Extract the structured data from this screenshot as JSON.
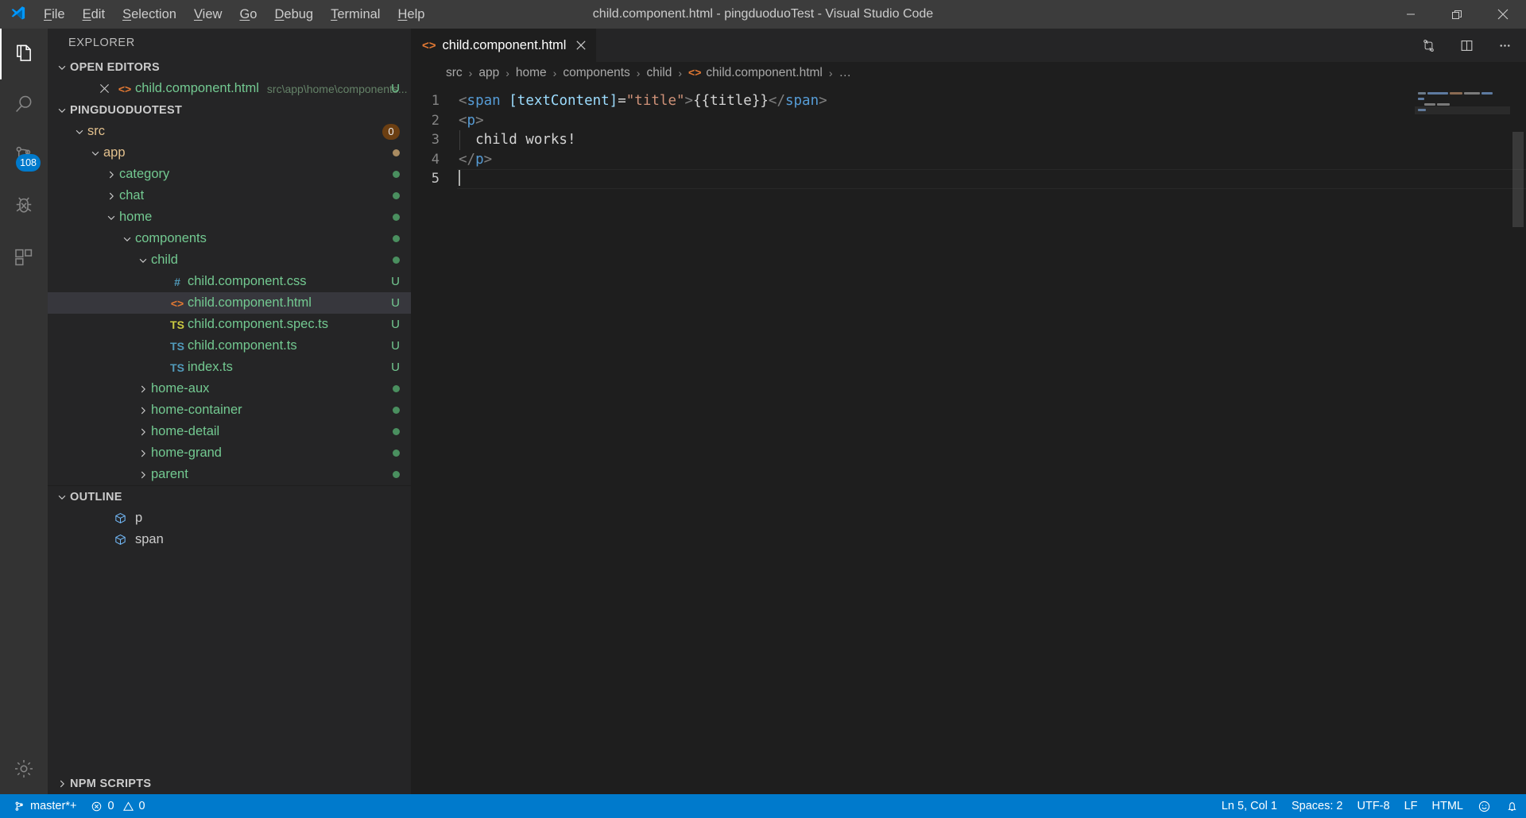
{
  "window": {
    "title": "child.component.html - pingduoduoTest - Visual Studio Code",
    "minimize_label": "Minimize",
    "maximize_label": "Restore",
    "close_label": "Close"
  },
  "menu": {
    "items": [
      {
        "label": "File",
        "mnemonic": "F"
      },
      {
        "label": "Edit",
        "mnemonic": "E"
      },
      {
        "label": "Selection",
        "mnemonic": "S"
      },
      {
        "label": "View",
        "mnemonic": "V"
      },
      {
        "label": "Go",
        "mnemonic": "G"
      },
      {
        "label": "Debug",
        "mnemonic": "D"
      },
      {
        "label": "Terminal",
        "mnemonic": "T"
      },
      {
        "label": "Help",
        "mnemonic": "H"
      }
    ]
  },
  "activitybar": {
    "items": [
      {
        "name": "explorer",
        "icon": "files-icon",
        "badge": null,
        "active": true
      },
      {
        "name": "search",
        "icon": "search-icon",
        "badge": null,
        "active": false
      },
      {
        "name": "source-control",
        "icon": "git-branch-icon",
        "badge": "108",
        "active": false
      },
      {
        "name": "debug",
        "icon": "bug-icon",
        "badge": null,
        "active": false
      },
      {
        "name": "extensions",
        "icon": "extensions-icon",
        "badge": null,
        "active": false
      },
      {
        "name": "manage",
        "icon": "gear-icon",
        "badge": null,
        "active": false
      }
    ]
  },
  "sidebar": {
    "title": "EXPLORER",
    "open_editors": {
      "header": "OPEN EDITORS",
      "expanded": true,
      "items": [
        {
          "label": "child.component.html",
          "description": "src\\app\\home\\components...",
          "icon": "html-file-icon",
          "badge": "U",
          "badge_color": "#73c991"
        }
      ]
    },
    "project": {
      "header": "PINGDUODUOTEST",
      "expanded": true,
      "items": [
        {
          "label": "src",
          "depth": 0,
          "type": "folder",
          "expanded": true,
          "color": "#e2c08d",
          "badge": "0",
          "badge_type": "count"
        },
        {
          "label": "app",
          "depth": 1,
          "type": "folder",
          "expanded": true,
          "color": "#e2c08d",
          "badge": "",
          "badge_type": "dot",
          "badge_color": "#a98b61"
        },
        {
          "label": "category",
          "depth": 2,
          "type": "folder",
          "expanded": false,
          "color": "#73c991",
          "badge": "",
          "badge_type": "dot",
          "badge_color": "#4a8f5f"
        },
        {
          "label": "chat",
          "depth": 2,
          "type": "folder",
          "expanded": false,
          "color": "#73c991",
          "badge": "",
          "badge_type": "dot",
          "badge_color": "#4a8f5f"
        },
        {
          "label": "home",
          "depth": 2,
          "type": "folder",
          "expanded": true,
          "color": "#73c991",
          "badge": "",
          "badge_type": "dot",
          "badge_color": "#4a8f5f"
        },
        {
          "label": "components",
          "depth": 3,
          "type": "folder",
          "expanded": true,
          "color": "#73c991",
          "badge": "",
          "badge_type": "dot",
          "badge_color": "#4a8f5f"
        },
        {
          "label": "child",
          "depth": 4,
          "type": "folder",
          "expanded": true,
          "color": "#73c991",
          "badge": "",
          "badge_type": "dot",
          "badge_color": "#4a8f5f"
        },
        {
          "label": "child.component.css",
          "depth": 5,
          "type": "file",
          "icon": "css-file-icon",
          "color": "#73c991",
          "badge": "U",
          "badge_type": "letter",
          "badge_color": "#73c991"
        },
        {
          "label": "child.component.html",
          "depth": 5,
          "type": "file",
          "icon": "html-file-icon",
          "color": "#73c991",
          "badge": "U",
          "badge_type": "letter",
          "badge_color": "#73c991",
          "selected": true
        },
        {
          "label": "child.component.spec.ts",
          "depth": 5,
          "type": "file",
          "icon": "ts-test-file-icon",
          "color": "#73c991",
          "badge": "U",
          "badge_type": "letter",
          "badge_color": "#73c991"
        },
        {
          "label": "child.component.ts",
          "depth": 5,
          "type": "file",
          "icon": "ts-file-icon",
          "color": "#73c991",
          "badge": "U",
          "badge_type": "letter",
          "badge_color": "#73c991"
        },
        {
          "label": "index.ts",
          "depth": 5,
          "type": "file",
          "icon": "ts-file-icon",
          "color": "#73c991",
          "badge": "U",
          "badge_type": "letter",
          "badge_color": "#73c991"
        },
        {
          "label": "home-aux",
          "depth": 4,
          "type": "folder",
          "expanded": false,
          "color": "#73c991",
          "badge": "",
          "badge_type": "dot",
          "badge_color": "#4a8f5f"
        },
        {
          "label": "home-container",
          "depth": 4,
          "type": "folder",
          "expanded": false,
          "color": "#73c991",
          "badge": "",
          "badge_type": "dot",
          "badge_color": "#4a8f5f"
        },
        {
          "label": "home-detail",
          "depth": 4,
          "type": "folder",
          "expanded": false,
          "color": "#73c991",
          "badge": "",
          "badge_type": "dot",
          "badge_color": "#4a8f5f"
        },
        {
          "label": "home-grand",
          "depth": 4,
          "type": "folder",
          "expanded": false,
          "color": "#73c991",
          "badge": "",
          "badge_type": "dot",
          "badge_color": "#4a8f5f"
        },
        {
          "label": "parent",
          "depth": 4,
          "type": "folder",
          "expanded": false,
          "color": "#73c991",
          "badge": "",
          "badge_type": "dot",
          "badge_color": "#4a8f5f"
        }
      ]
    },
    "outline": {
      "header": "OUTLINE",
      "expanded": true,
      "items": [
        {
          "label": "p",
          "icon": "symbol-module-icon"
        },
        {
          "label": "span",
          "icon": "symbol-module-icon"
        }
      ]
    },
    "npm_scripts": {
      "header": "NPM SCRIPTS",
      "expanded": false
    }
  },
  "editor": {
    "tab": {
      "label": "child.component.html",
      "icon": "html-file-icon",
      "close_label": "×",
      "dirty": false
    },
    "actions": [
      {
        "name": "open-changes-icon"
      },
      {
        "name": "split-editor-icon"
      },
      {
        "name": "more-actions-icon"
      }
    ],
    "breadcrumbs": [
      {
        "label": "src"
      },
      {
        "label": "app"
      },
      {
        "label": "home"
      },
      {
        "label": "components"
      },
      {
        "label": "child"
      },
      {
        "label": "child.component.html",
        "icon": "html-file-icon"
      },
      {
        "label": "…"
      }
    ],
    "line_numbers": [
      "1",
      "2",
      "3",
      "4",
      "5"
    ],
    "active_line": 5,
    "lines": [
      {
        "n": 1,
        "tokens": [
          {
            "t": "<",
            "c": "tok-brk"
          },
          {
            "t": "span",
            "c": "tok-tag"
          },
          {
            "t": " ",
            "c": "tok-txt"
          },
          {
            "t": "[textContent]",
            "c": "tok-attr"
          },
          {
            "t": "=",
            "c": "tok-eq"
          },
          {
            "t": "\"title\"",
            "c": "tok-str"
          },
          {
            "t": ">",
            "c": "tok-brk"
          },
          {
            "t": "{{title}}",
            "c": "tok-txt"
          },
          {
            "t": "</",
            "c": "tok-brk"
          },
          {
            "t": "span",
            "c": "tok-tag"
          },
          {
            "t": ">",
            "c": "tok-brk"
          }
        ]
      },
      {
        "n": 2,
        "tokens": [
          {
            "t": "<",
            "c": "tok-brk"
          },
          {
            "t": "p",
            "c": "tok-tag"
          },
          {
            "t": ">",
            "c": "tok-brk"
          }
        ]
      },
      {
        "n": 3,
        "tokens": [
          {
            "t": "  child works!",
            "c": "tok-txt"
          }
        ]
      },
      {
        "n": 4,
        "tokens": [
          {
            "t": "</",
            "c": "tok-brk"
          },
          {
            "t": "p",
            "c": "tok-tag"
          },
          {
            "t": ">",
            "c": "tok-brk"
          }
        ]
      },
      {
        "n": 5,
        "tokens": []
      }
    ]
  },
  "statusbar": {
    "left": [
      {
        "name": "git-branch",
        "icon": "git-branch-icon",
        "label": "master*+"
      },
      {
        "name": "problems",
        "icon": "error-warning-icon",
        "errors": "0",
        "warnings": "0"
      }
    ],
    "right": [
      {
        "name": "cursor-position",
        "label": "Ln 5, Col 1"
      },
      {
        "name": "indentation",
        "label": "Spaces: 2"
      },
      {
        "name": "encoding",
        "label": "UTF-8"
      },
      {
        "name": "eol",
        "label": "LF"
      },
      {
        "name": "language-mode",
        "label": "HTML"
      },
      {
        "name": "feedback",
        "icon": "smiley-icon"
      },
      {
        "name": "notifications",
        "icon": "bell-icon"
      }
    ]
  },
  "colors": {
    "accent": "#007acc",
    "titlebar_bg": "#3c3c3c",
    "sidebar_bg": "#252526",
    "editor_bg": "#1e1e1e",
    "activitybar_bg": "#333333",
    "untracked_green": "#73c991",
    "modified_yellow": "#e2c08d",
    "html_orange": "#e37933"
  }
}
